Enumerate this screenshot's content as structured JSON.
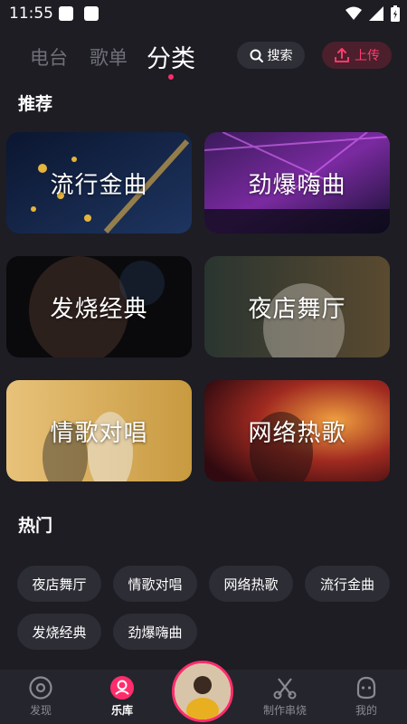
{
  "status_bar": {
    "time": "11:55"
  },
  "top_tabs": [
    {
      "label": "电台",
      "active": false
    },
    {
      "label": "歌单",
      "active": false
    },
    {
      "label": "分类",
      "active": true
    }
  ],
  "search": {
    "label": "搜索"
  },
  "upload": {
    "label": "上传"
  },
  "recommend": {
    "title": "推荐",
    "cards": [
      {
        "label": "流行金曲"
      },
      {
        "label": "劲爆嗨曲"
      },
      {
        "label": "发烧经典"
      },
      {
        "label": "夜店舞厅"
      },
      {
        "label": "情歌对唱"
      },
      {
        "label": "网络热歌"
      }
    ]
  },
  "hot": {
    "title": "热门",
    "tags": [
      "夜店舞厅",
      "情歌对唱",
      "网络热歌",
      "流行金曲",
      "发烧经典",
      "劲爆嗨曲"
    ]
  },
  "bottom_nav": [
    {
      "label": "发现",
      "icon": "disc-icon",
      "active": false
    },
    {
      "label": "乐库",
      "icon": "library-icon",
      "active": true
    },
    {
      "label": "制作串烧",
      "icon": "scissors-icon",
      "active": false
    },
    {
      "label": "我的",
      "icon": "profile-icon",
      "active": false
    }
  ],
  "colors": {
    "accent": "#ff2d6b",
    "background": "#1d1d23",
    "chip": "#2c2d35"
  }
}
